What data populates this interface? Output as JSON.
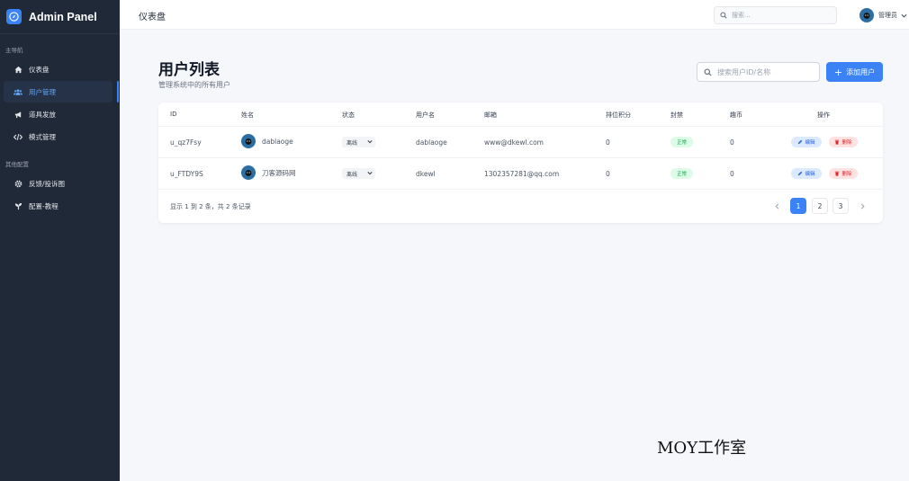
{
  "sidebar": {
    "brand": "Admin Panel",
    "section_main": "主导航",
    "section_other": "其他配置",
    "items": [
      {
        "label": "仪表盘"
      },
      {
        "label": "用户管理"
      },
      {
        "label": "道具发放"
      },
      {
        "label": "模式管理"
      },
      {
        "label": "反馈/投诉图"
      },
      {
        "label": "配置-教程"
      }
    ]
  },
  "topbar": {
    "breadcrumb": "仪表盘",
    "search_placeholder": "搜索...",
    "user_name": "管理员"
  },
  "page": {
    "title": "用户列表",
    "subtitle": "管理系统中的所有用户",
    "search_placeholder": "搜索用户ID/名称",
    "add_label": "添加用户"
  },
  "table": {
    "headers": [
      "ID",
      "姓名",
      "状态",
      "用户名",
      "邮箱",
      "排位积分",
      "封禁",
      "趣币",
      "操作"
    ],
    "rows": [
      {
        "id": "u_qz7Fsy",
        "name": "dablaoge",
        "status": "离线",
        "username": "dablaoge",
        "email": "www@dkewl.com",
        "score": "0",
        "ban": "正常",
        "coins": "0"
      },
      {
        "id": "u_FTDY9S",
        "name": "刀客源码网",
        "status": "离线",
        "username": "dkewl",
        "email": "1302357281@qq.com",
        "score": "0",
        "ban": "正常",
        "coins": "0"
      }
    ],
    "edit_label": "编辑",
    "delete_label": "删除",
    "footer": "显示 1 到 2 条，共 2 条记录",
    "pages": [
      "1",
      "2",
      "3"
    ]
  },
  "watermark": "MOY工作室",
  "colors": {
    "accent": "#3b82f6",
    "sidebar_bg": "#1f2937",
    "ok": "#16a34a",
    "danger": "#dc2626"
  }
}
